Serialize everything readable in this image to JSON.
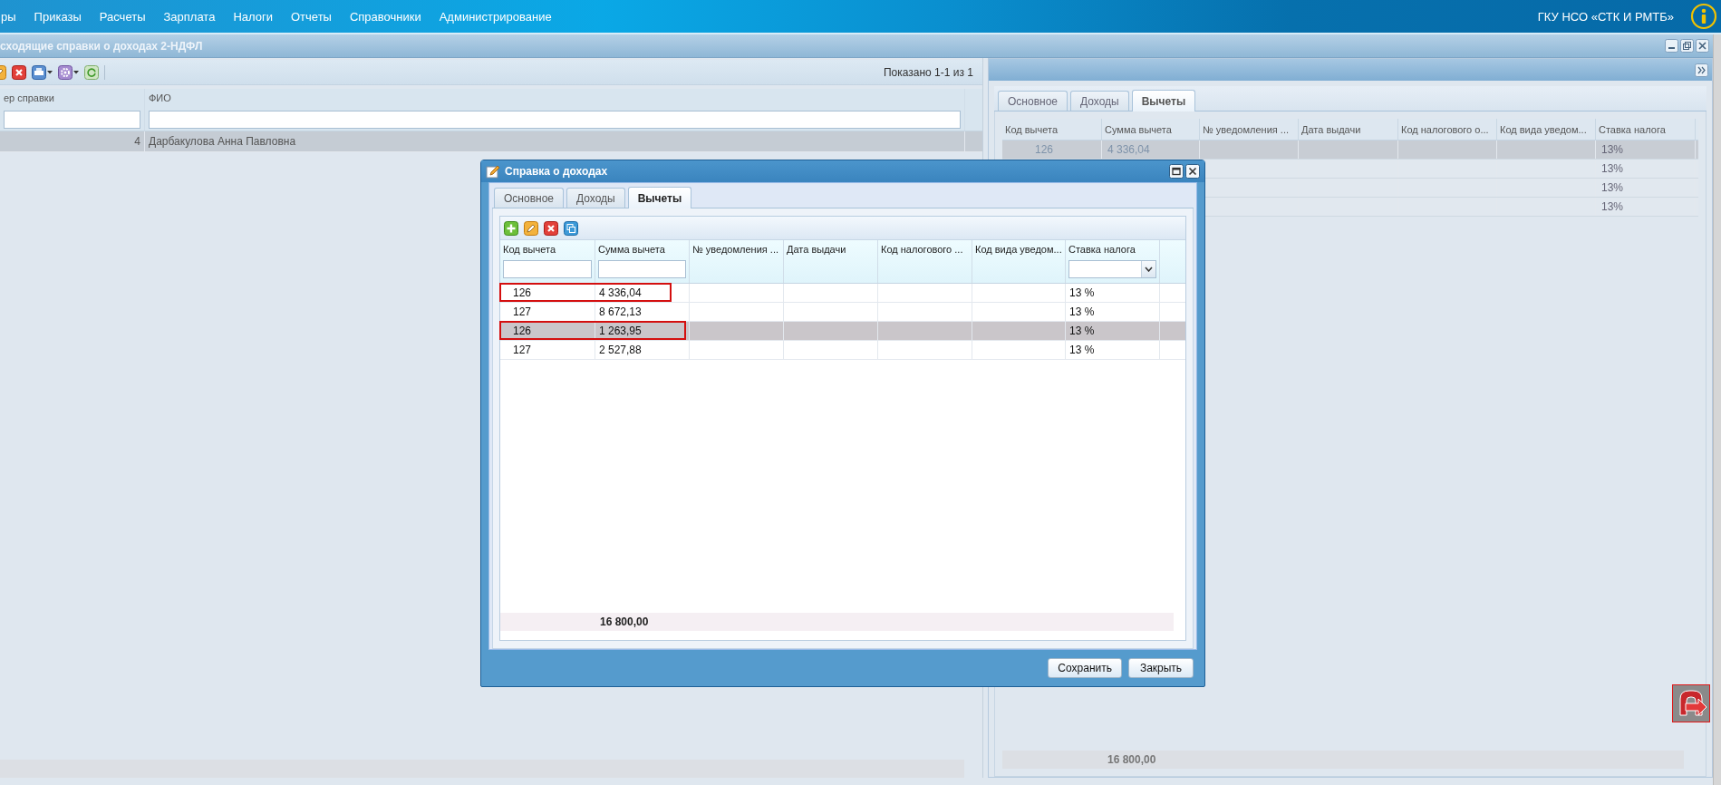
{
  "top_menu": {
    "items": [
      "ры",
      "Приказы",
      "Расчеты",
      "Зарплата",
      "Налоги",
      "Отчеты",
      "Справочники",
      "Администрирование"
    ],
    "organization": "ГКУ НСО «СТК И РМТБ»"
  },
  "list_window": {
    "title": "сходящие справки о доходах 2-НДФЛ",
    "paging": "Показано 1-1 из 1",
    "columns": [
      {
        "label": "ер справки",
        "kind": "filter"
      },
      {
        "label": "ФИО",
        "kind": "filter"
      }
    ],
    "rows": [
      {
        "cells": [
          "4",
          "Дарбакулова Анна Павловна"
        ],
        "selected": true
      }
    ]
  },
  "detail_panel": {
    "tabs": [
      {
        "label": "Основное",
        "selected": false
      },
      {
        "label": "Доходы",
        "selected": false
      },
      {
        "label": "Вычеты",
        "selected": true
      }
    ],
    "columns": [
      "Код вычета",
      "Сумма вычета",
      "№ уведомления ...",
      "Дата выдачи",
      "Код налогового о...",
      "Код вида уведом...",
      "Ставка налога"
    ],
    "rows": [
      {
        "code": "126",
        "amount": "4 336,04",
        "rate": "13%",
        "selected": true
      },
      {
        "rate": "13%",
        "selected": false
      },
      {
        "rate": "13%",
        "selected": false
      },
      {
        "rate": "13%",
        "selected": false
      }
    ],
    "total": "16 800,00"
  },
  "dialog": {
    "title": "Справка о доходах",
    "tabs": [
      {
        "label": "Основное",
        "selected": false
      },
      {
        "label": "Доходы",
        "selected": false
      },
      {
        "label": "Вычеты",
        "selected": true
      }
    ],
    "columns": [
      {
        "label": "Код вычета",
        "kind": "filter"
      },
      {
        "label": "Сумма вычета",
        "kind": "filter"
      },
      {
        "label": "№ уведомления ...",
        "kind": "plain"
      },
      {
        "label": "Дата выдачи",
        "kind": "plain"
      },
      {
        "label": "Код налогового ...",
        "kind": "plain"
      },
      {
        "label": "Код вида уведом...",
        "kind": "plain"
      },
      {
        "label": "Ставка налога",
        "kind": "combo"
      }
    ],
    "rows": [
      {
        "code": "126",
        "amount": "4 336,04",
        "rate": "13 %",
        "selected": false,
        "marked": true
      },
      {
        "code": "127",
        "amount": "8 672,13",
        "rate": "13 %",
        "selected": false,
        "marked": false
      },
      {
        "code": "126",
        "amount": "1 263,95",
        "rate": "13 %",
        "selected": true,
        "marked": true
      },
      {
        "code": "127",
        "amount": "2 527,88",
        "rate": "13 %",
        "selected": false,
        "marked": false
      }
    ],
    "total": "16 800,00",
    "buttons": [
      "Сохранить",
      "Закрыть"
    ]
  }
}
